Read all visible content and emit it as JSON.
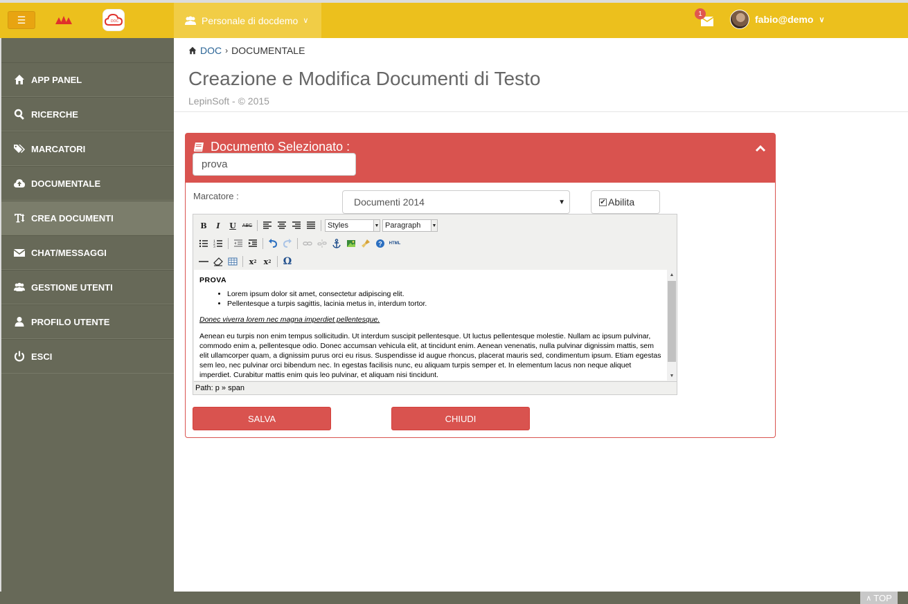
{
  "topbar": {
    "org_menu_label": "Personale di docdemo",
    "messages_count": "1",
    "user_name": "fabio@demo"
  },
  "sidebar": {
    "items": [
      {
        "label": "APP PANEL",
        "icon": "home-icon"
      },
      {
        "label": "RICERCHE",
        "icon": "search-icon"
      },
      {
        "label": "MARCATORI",
        "icon": "tags-icon"
      },
      {
        "label": "DOCUMENTALE",
        "icon": "cloud-upload-icon"
      },
      {
        "label": "CREA DOCUMENTI",
        "icon": "text-height-icon"
      },
      {
        "label": "CHAT/MESSAGGI",
        "icon": "envelope-icon"
      },
      {
        "label": "GESTIONE UTENTI",
        "icon": "users-icon"
      },
      {
        "label": "PROFILO UTENTE",
        "icon": "user-icon"
      },
      {
        "label": "ESCI",
        "icon": "power-icon"
      }
    ]
  },
  "breadcrumb": {
    "root": "DOC",
    "current": "DOCUMENTALE"
  },
  "page": {
    "title": "Creazione e Modifica Documenti di Testo",
    "subtitle": "LepinSoft - © 2015"
  },
  "panel": {
    "title": "Documento Selezionato :",
    "document_name": "prova",
    "marcatore_label": "Marcatore :",
    "marcatore_value": "Documenti 2014",
    "abilita_label": "Abilita",
    "save_label": "SALVA",
    "close_label": "CHIUDI"
  },
  "editor": {
    "styles_label": "Styles",
    "format_label": "Paragraph",
    "heading": "PROVA",
    "bullets": [
      "Lorem ipsum dolor sit amet, consectetur adipiscing elit.",
      "Pellentesque a turpis sagittis, lacinia metus in, interdum tortor."
    ],
    "emphasis": "Donec viverra lorem nec magna imperdiet pellentesque.",
    "paragraph": "Aenean eu turpis non enim tempus sollicitudin. Ut interdum suscipit pellentesque. Ut luctus pellentesque molestie. Nullam ac ipsum pulvinar, commodo enim a, pellentesque odio. Donec accumsan vehicula elit, at tincidunt enim. Aenean venenatis, nulla pulvinar dignissim mattis, sem elit ullamcorper quam, a dignissim purus orci eu risus. Suspendisse id augue rhoncus, placerat mauris sed, condimentum ipsum. Etiam egestas sem leo, nec pulvinar orci bibendum nec. In egestas facilisis nunc, eu aliquam turpis semper et. In elementum lacus non neque aliquet imperdiet. Curabitur mattis enim quis leo pulvinar, et aliquam nisi tincidunt.",
    "path": "Path: p » span"
  },
  "footer": {
    "top_label": "TOP"
  },
  "colors": {
    "topbar": "#ecc01d",
    "sidebar": "#676958",
    "danger": "#d9534f",
    "link": "#2a6496"
  }
}
